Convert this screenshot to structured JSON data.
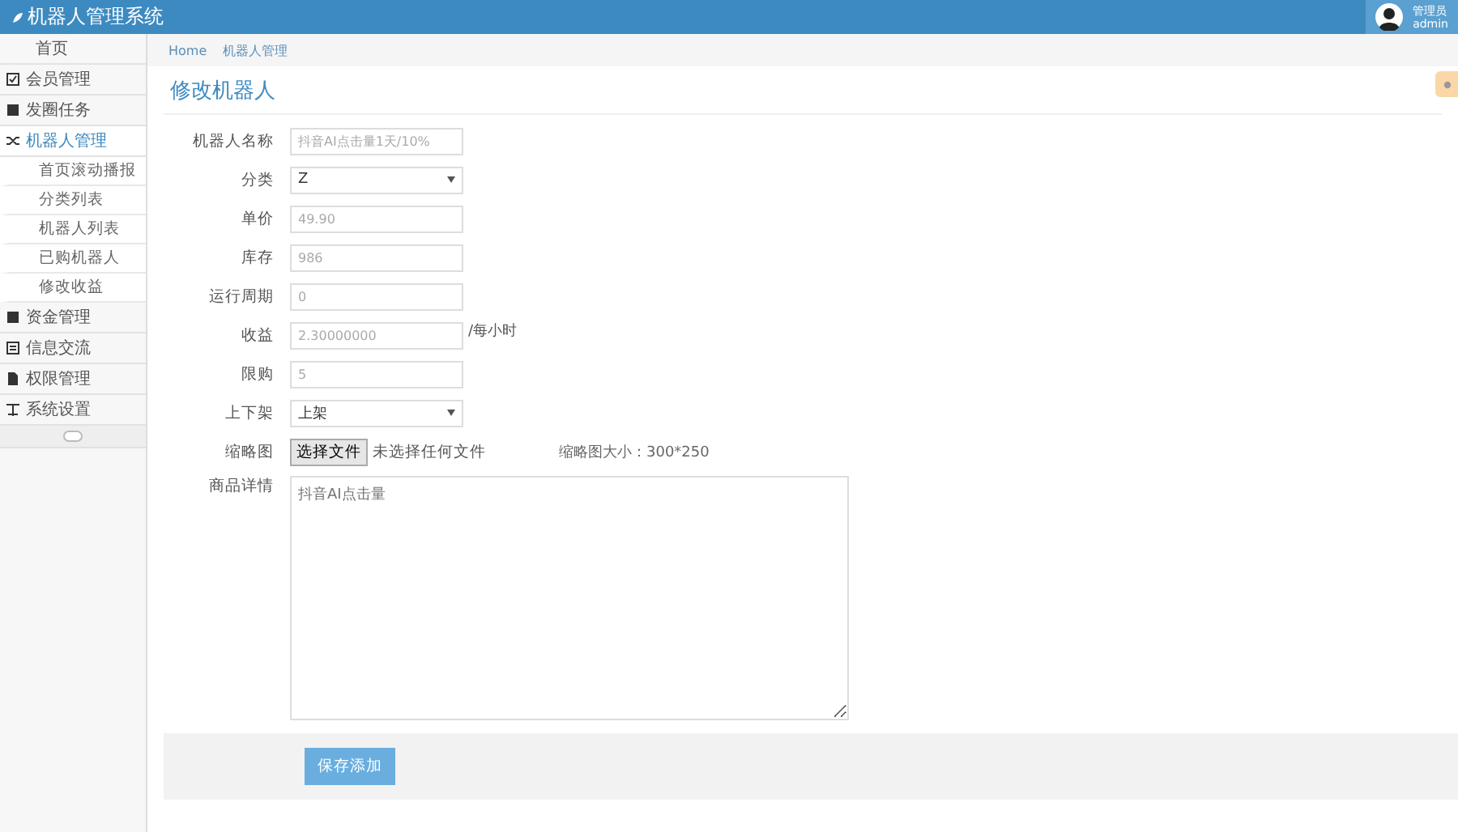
{
  "header": {
    "title": "机器人管理系统",
    "user": {
      "role": "管理员",
      "name": "admin"
    }
  },
  "sidebar": {
    "items": [
      {
        "label": "首页",
        "expanded": false
      },
      {
        "label": "会员管理",
        "expanded": false
      },
      {
        "label": "发圈任务",
        "expanded": false
      },
      {
        "label": "机器人管理",
        "expanded": true,
        "children": [
          {
            "label": "首页滚动播报"
          },
          {
            "label": "分类列表"
          },
          {
            "label": "机器人列表"
          },
          {
            "label": "已购机器人"
          },
          {
            "label": "修改收益"
          }
        ]
      },
      {
        "label": "资金管理",
        "expanded": false
      },
      {
        "label": "信息交流",
        "expanded": false
      },
      {
        "label": "权限管理",
        "expanded": false
      },
      {
        "label": "系统设置",
        "expanded": false
      }
    ]
  },
  "breadcrumb": [
    "Home",
    "机器人管理"
  ],
  "page_title": "修改机器人",
  "form": {
    "fields": [
      {
        "kind": "text",
        "label": "机器人名称",
        "placeholder": "抖音AI点击量1天/10%"
      },
      {
        "kind": "select",
        "label": "分类",
        "value": "Z"
      },
      {
        "kind": "text",
        "label": "单价",
        "placeholder": "49.90"
      },
      {
        "kind": "text",
        "label": "库存",
        "placeholder": "986"
      },
      {
        "kind": "text",
        "label": "运行周期",
        "placeholder": "0"
      },
      {
        "kind": "text",
        "label": "收益",
        "placeholder": "2.30000000",
        "suffix": "/每小时"
      },
      {
        "kind": "text",
        "label": "限购",
        "placeholder": "5"
      },
      {
        "kind": "select",
        "label": "上下架",
        "value": "上架"
      },
      {
        "kind": "file",
        "label": "缩略图",
        "button": "选择文件",
        "status": "未选择任何文件",
        "hint": "缩略图大小：300*250"
      },
      {
        "kind": "textarea",
        "label": "商品详情",
        "placeholder": "抖音AI点击量"
      }
    ],
    "submit": "保存添加"
  }
}
